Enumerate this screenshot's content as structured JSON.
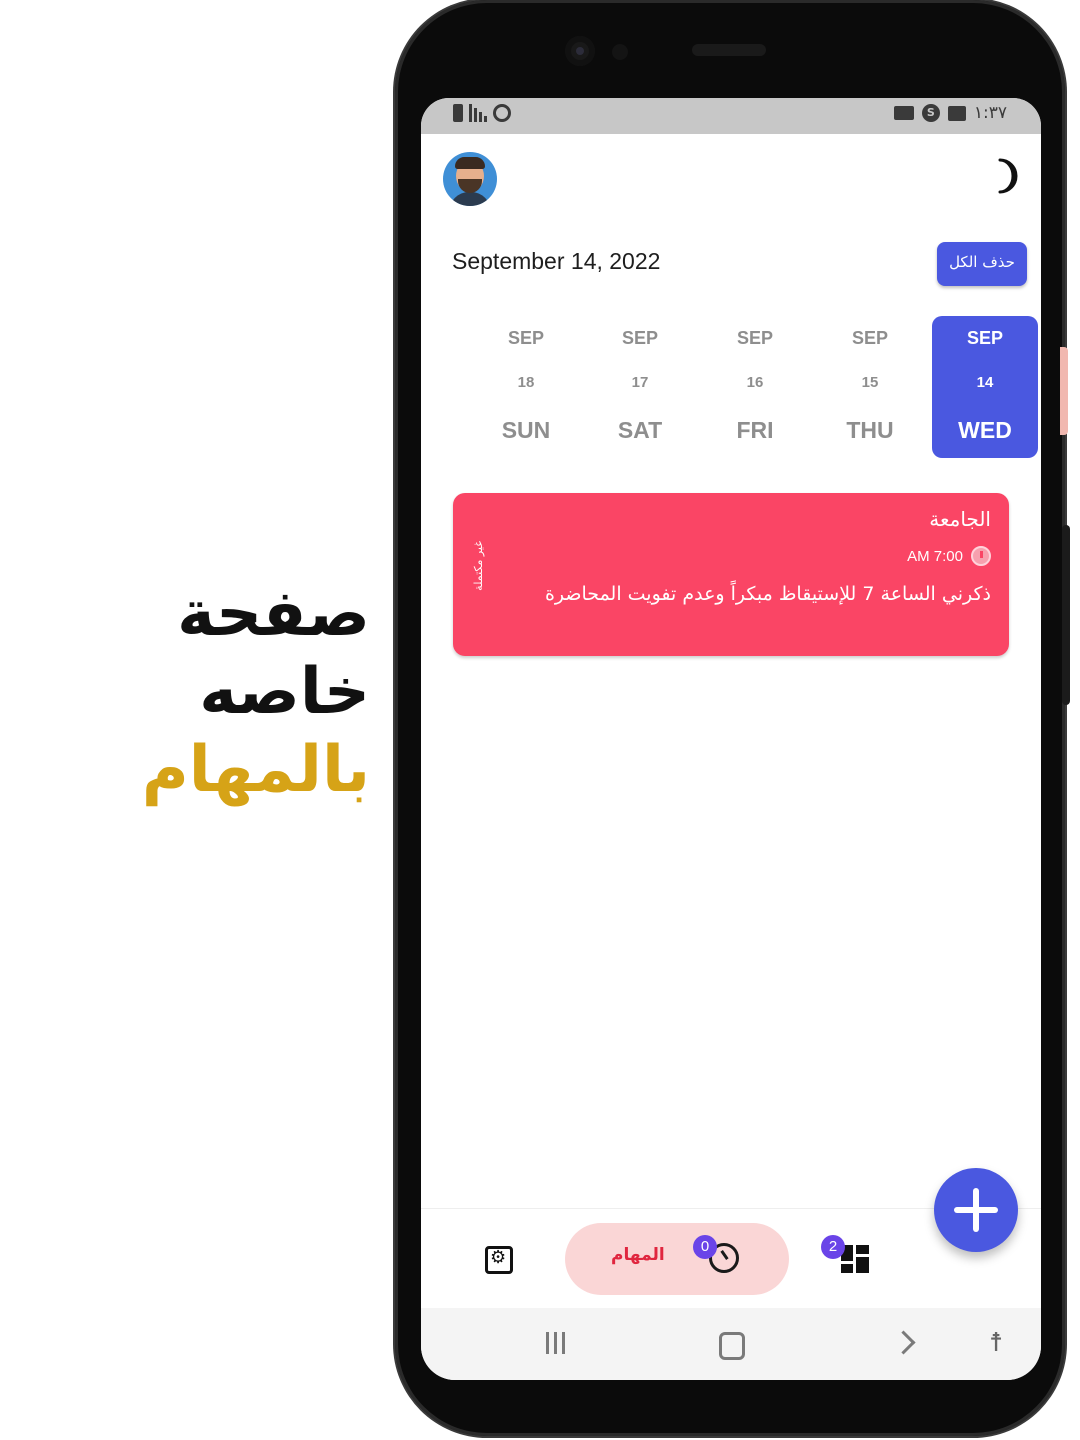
{
  "promo": {
    "line1": "صفحة خاصه",
    "line2": "بالمهام",
    "line1_color": "#111111",
    "line2_color": "#d6a317"
  },
  "status_bar": {
    "time": "١:٣٧",
    "left_icons": [
      "battery-icon",
      "signal-icon",
      "alarm-icon"
    ],
    "right_icons": [
      "video-icon",
      "s-app-icon",
      "message-icon"
    ]
  },
  "header": {
    "avatar": "avatar",
    "theme_icon": "moon-icon"
  },
  "date_heading": "September 14, 2022",
  "delete_all_label": "حذف الكل",
  "calendar": {
    "days": [
      {
        "month": "SEP",
        "day": "18",
        "weekday": "SUN",
        "selected": false
      },
      {
        "month": "SEP",
        "day": "17",
        "weekday": "SAT",
        "selected": false
      },
      {
        "month": "SEP",
        "day": "16",
        "weekday": "FRI",
        "selected": false
      },
      {
        "month": "SEP",
        "day": "15",
        "weekday": "THU",
        "selected": false
      },
      {
        "month": "SEP",
        "day": "14",
        "weekday": "WED",
        "selected": true
      }
    ]
  },
  "task": {
    "title": "الجامعة",
    "time": "AM 7:00",
    "description": "ذكرني الساعة 7  للإستيقاظ مبكراً وعدم تفويت المحاضرة",
    "status": "غير مكتملة",
    "color": "#fa4565"
  },
  "bottom_nav": {
    "tasks_label": "المهام",
    "history_badge": "0",
    "dashboard_badge": "2"
  },
  "colors": {
    "accent": "#4a58e0",
    "task_card": "#fa4565",
    "active_nav_bg": "#fad6d6",
    "badge": "#6a44e8"
  }
}
